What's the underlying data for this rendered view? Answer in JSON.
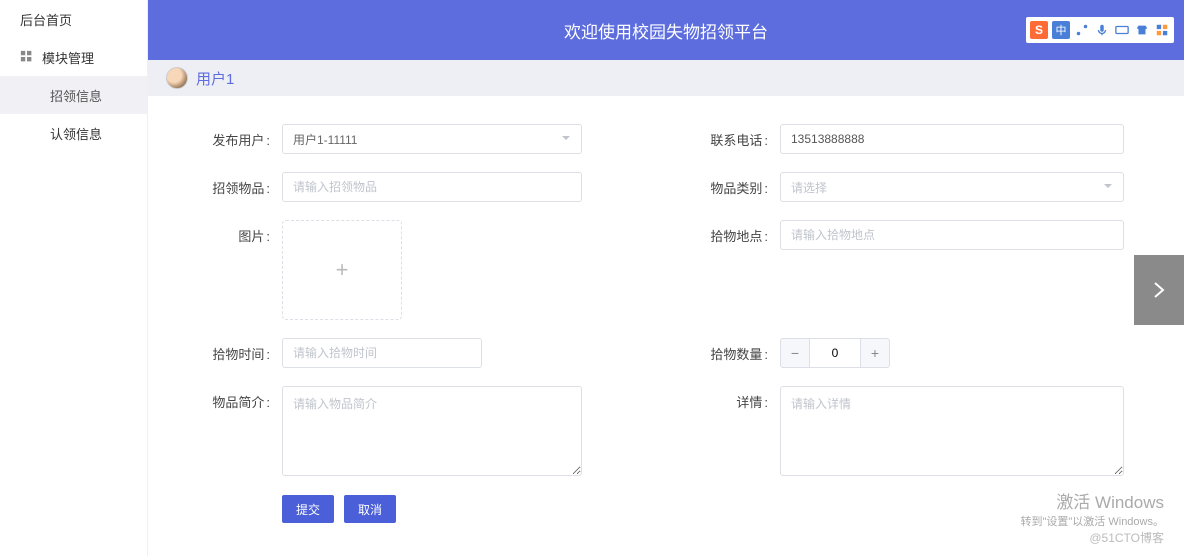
{
  "header": {
    "title": "欢迎使用校园失物招领平台",
    "ime": {
      "s": "S",
      "cn": "中"
    }
  },
  "sidebar": {
    "home": "后台首页",
    "module": "模块管理",
    "found": "招领信息",
    "claim": "认领信息"
  },
  "userbar": {
    "name": "用户1"
  },
  "form": {
    "publisher": {
      "label": "发布用户",
      "value": "用户1-11111"
    },
    "phone": {
      "label": "联系电话",
      "value": "13513888888"
    },
    "item": {
      "label": "招领物品",
      "placeholder": "请输入招领物品"
    },
    "category": {
      "label": "物品类别",
      "placeholder": "请选择"
    },
    "image": {
      "label": "图片"
    },
    "location": {
      "label": "拾物地点",
      "placeholder": "请输入拾物地点"
    },
    "time": {
      "label": "拾物时间",
      "placeholder": "请输入拾物时间"
    },
    "quantity": {
      "label": "拾物数量",
      "value": "0"
    },
    "intro": {
      "label": "物品简介",
      "placeholder": "请输入物品简介"
    },
    "detail": {
      "label": "详情",
      "placeholder": "请输入详情"
    }
  },
  "actions": {
    "submit": "提交",
    "cancel": "取消"
  },
  "watermark": {
    "title": "激活 Windows",
    "sub": "转到\"设置\"以激活 Windows。",
    "blog": "@51CTO博客"
  }
}
